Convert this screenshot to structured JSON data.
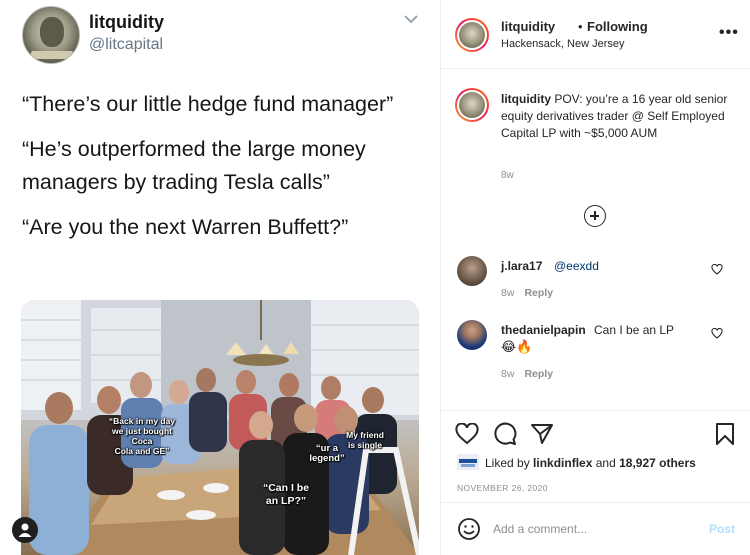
{
  "tweet": {
    "name": "litquidity",
    "handle": "@litcapital",
    "lines": [
      "“There’s our little hedge fund manager”",
      "“He’s outperformed the large money managers by trading Tesla calls”",
      "“Are you the next Warren Buffett?”"
    ],
    "captions": {
      "back_in_my_day": "“Back in my day\nwe just bought Coca\nCola and GE”",
      "my_friend": "My friend\nis single",
      "ur_a_legend": "“ur a\nlegend”",
      "can_i_be": "“Can I be\nan LP?”"
    }
  },
  "post": {
    "username": "litquidity",
    "separator": "•",
    "follow_state": "Following",
    "location": "Hackensack, New Jersey",
    "more_label": "•••",
    "caption_user": "litquidity",
    "caption_text": "POV: you’re a 16 year old senior equity derivatives trader @ Self Employed Capital LP with ~$5,000 AUM",
    "caption_time": "8w",
    "comments": [
      {
        "user": "j.lara17",
        "text": "@eexdd",
        "time": "8w",
        "reply": "Reply"
      },
      {
        "user": "thedanielpapin",
        "text": "Can I be an LP",
        "emoji": "😂🔥",
        "time": "8w",
        "reply": "Reply"
      }
    ],
    "likes_prefix": "Liked by",
    "likes_user": "linkdinflex",
    "likes_mid": "and",
    "likes_count": "18,927 others",
    "date": "NOVEMBER 26, 2020",
    "add_comment_placeholder": "Add a comment...",
    "post_label": "Post"
  }
}
